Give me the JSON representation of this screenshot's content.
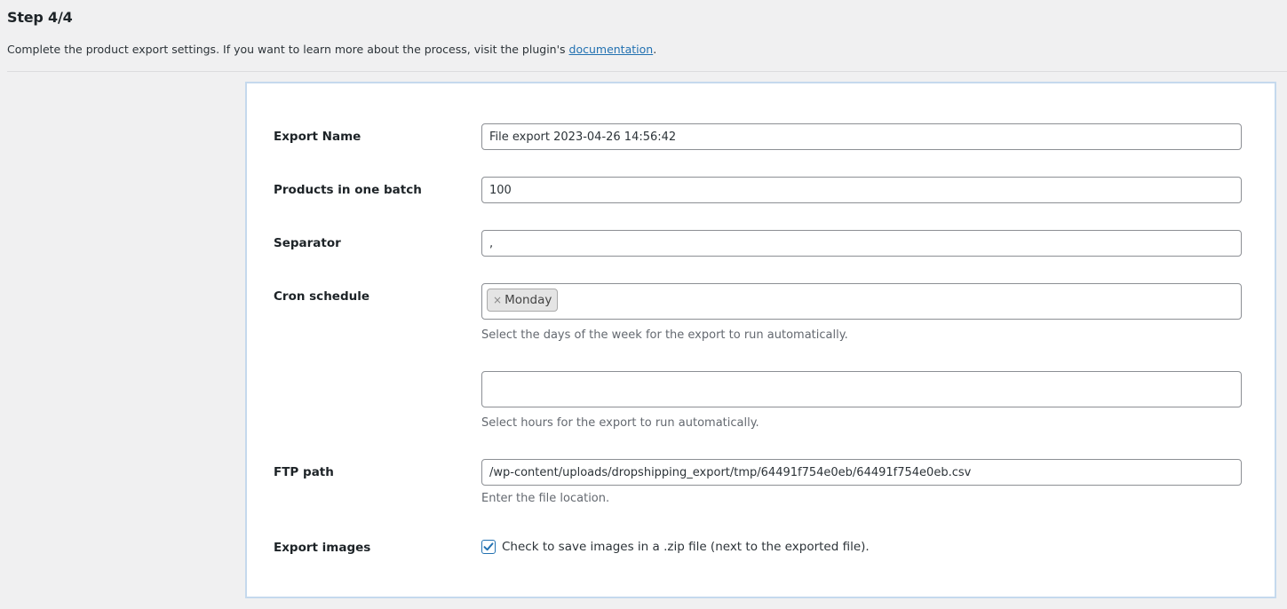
{
  "header": {
    "title": "Step 4/4",
    "intro_text": "Complete the product export settings. If you want to learn more about the process, visit the plugin's ",
    "intro_link": "documentation",
    "intro_end": "."
  },
  "form": {
    "export_name": {
      "label": "Export Name",
      "value": "File export 2023-04-26 14:56:42"
    },
    "batch": {
      "label": "Products in one batch",
      "value": "100"
    },
    "separator": {
      "label": "Separator",
      "value": ","
    },
    "cron": {
      "label": "Cron schedule",
      "days_selected": [
        "Monday"
      ],
      "tag_remove": "×",
      "days_help": "Select the days of the week for the export to run automatically.",
      "hours_selected": [],
      "hours_help": "Select hours for the export to run automatically."
    },
    "ftp": {
      "label": "FTP path",
      "value": "/wp-content/uploads/dropshipping_export/tmp/64491f754e0eb/64491f754e0eb.csv",
      "help": "Enter the file location."
    },
    "images": {
      "label": "Export images",
      "checked": true,
      "check_label": "Check to save images in a .zip file (next to the exported file)."
    }
  },
  "colors": {
    "accent": "#2271b1",
    "panel_border": "#c5d9ed",
    "background": "#f0f0f1"
  }
}
